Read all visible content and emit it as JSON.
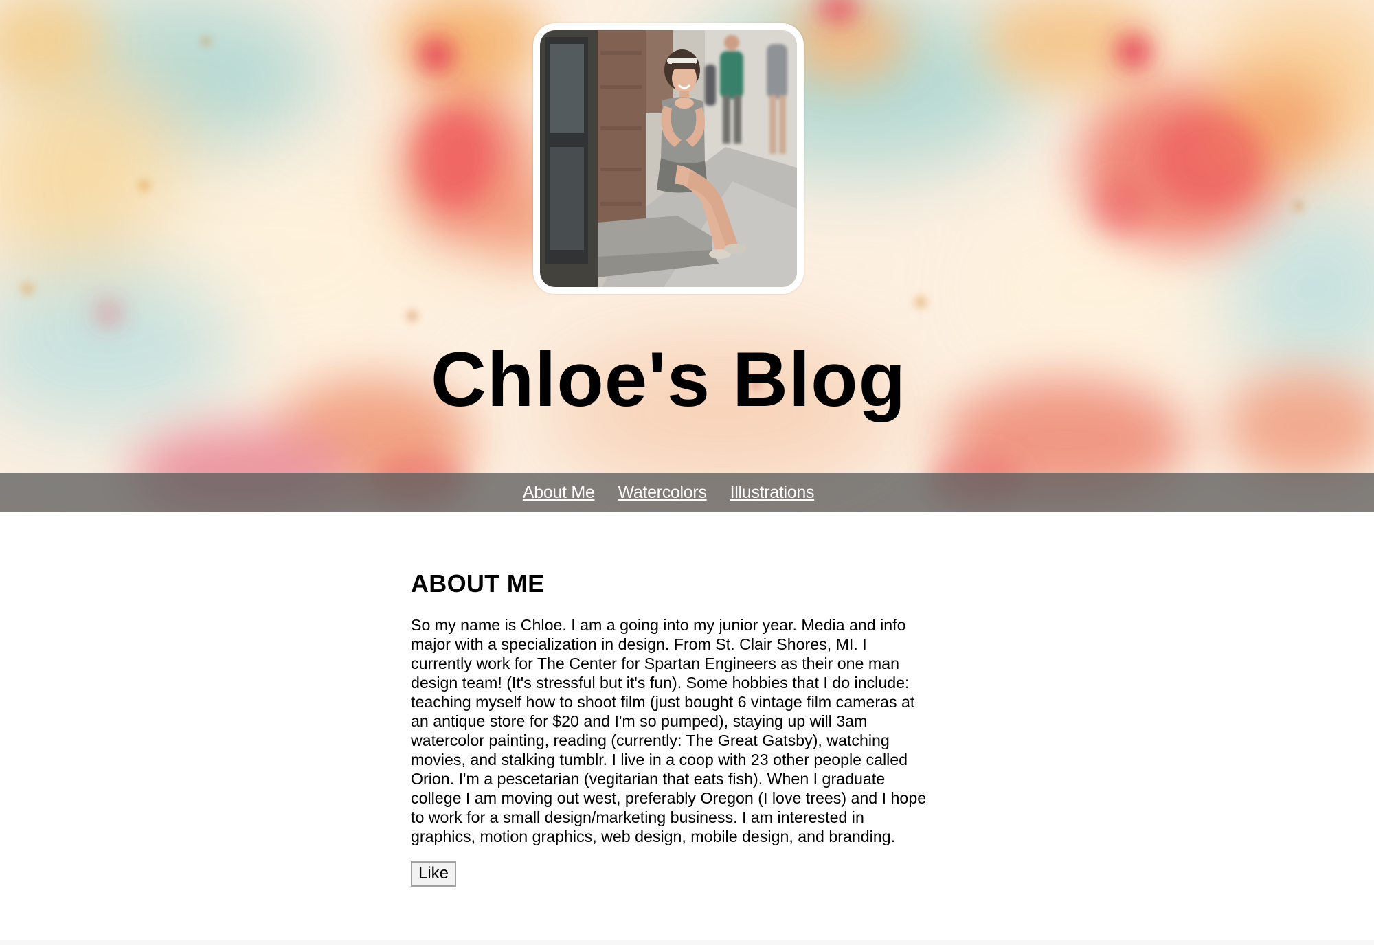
{
  "header": {
    "title": "Chloe's Blog",
    "avatar_alt": "Chloe sitting on a step on a city sidewalk"
  },
  "nav": {
    "items": [
      {
        "label": "About Me"
      },
      {
        "label": "Watercolors"
      },
      {
        "label": "Illustrations"
      }
    ]
  },
  "about": {
    "heading": "ABOUT ME",
    "body": "So my name is Chloe. I am a going into my junior year. Media and info major with a specialization in design. From St. Clair Shores, MI. I currently work for The Center for Spartan Engineers as their one man design team! (It's stressful but it's fun). Some hobbies that I do include: teaching myself how to shoot film (just bought 6 vintage film cameras at an antique store for $20 and I'm so pumped), staying up will 3am watercolor painting, reading (currently: The Great Gatsby), watching movies, and stalking tumblr. I live in a coop with 23 other people called Orion. I'm a pescetarian (vegitarian that eats fish). When I graduate college I am moving out west, preferably Oregon (I love trees) and I hope to work for a small design/marketing business. I am interested in graphics, motion graphics, web design, mobile design, and branding.",
    "like_label": "Like"
  },
  "colors": {
    "nav_bg": "#5f5f5f",
    "title": "#000000",
    "watercolor_red": "#e84a4a",
    "watercolor_orange": "#f2a65a",
    "watercolor_teal": "#9fcfcc"
  }
}
